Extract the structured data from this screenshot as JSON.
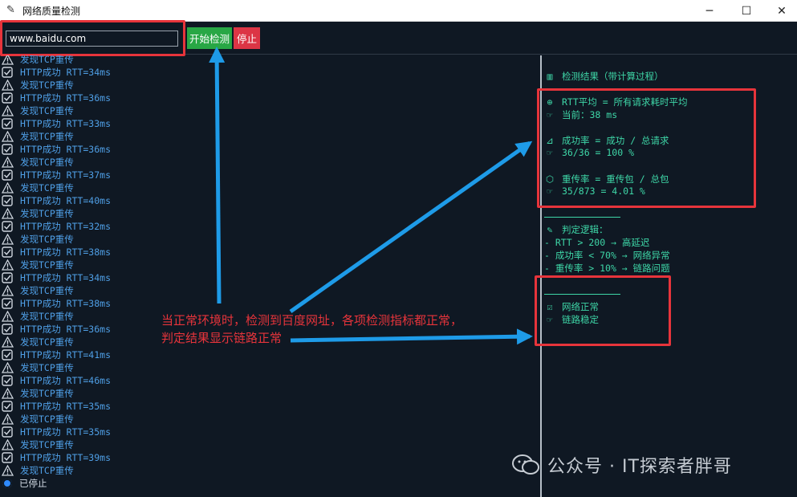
{
  "window": {
    "title": "网络质量检测",
    "app_icon": "feather-icon",
    "controls": [
      "─",
      "☐",
      "✕"
    ]
  },
  "toolbar": {
    "url_value": "www.baidu.com",
    "start_label": "开始检测",
    "stop_label": "停止"
  },
  "log": [
    {
      "type": "warn",
      "text": "发现TCP重传"
    },
    {
      "type": "ok",
      "text": "HTTP成功 RTT=34ms"
    },
    {
      "type": "warn",
      "text": "发现TCP重传"
    },
    {
      "type": "ok",
      "text": "HTTP成功 RTT=36ms"
    },
    {
      "type": "warn",
      "text": "发现TCP重传"
    },
    {
      "type": "ok",
      "text": "HTTP成功 RTT=33ms"
    },
    {
      "type": "warn",
      "text": "发现TCP重传"
    },
    {
      "type": "ok",
      "text": "HTTP成功 RTT=36ms"
    },
    {
      "type": "warn",
      "text": "发现TCP重传"
    },
    {
      "type": "ok",
      "text": "HTTP成功 RTT=37ms"
    },
    {
      "type": "warn",
      "text": "发现TCP重传"
    },
    {
      "type": "ok",
      "text": "HTTP成功 RTT=40ms"
    },
    {
      "type": "warn",
      "text": "发现TCP重传"
    },
    {
      "type": "ok",
      "text": "HTTP成功 RTT=32ms"
    },
    {
      "type": "warn",
      "text": "发现TCP重传"
    },
    {
      "type": "ok",
      "text": "HTTP成功 RTT=38ms"
    },
    {
      "type": "warn",
      "text": "发现TCP重传"
    },
    {
      "type": "ok",
      "text": "HTTP成功 RTT=34ms"
    },
    {
      "type": "warn",
      "text": "发现TCP重传"
    },
    {
      "type": "ok",
      "text": "HTTP成功 RTT=38ms"
    },
    {
      "type": "warn",
      "text": "发现TCP重传"
    },
    {
      "type": "ok",
      "text": "HTTP成功 RTT=36ms"
    },
    {
      "type": "warn",
      "text": "发现TCP重传"
    },
    {
      "type": "ok",
      "text": "HTTP成功 RTT=41ms"
    },
    {
      "type": "warn",
      "text": "发现TCP重传"
    },
    {
      "type": "ok",
      "text": "HTTP成功 RTT=46ms"
    },
    {
      "type": "warn",
      "text": "发现TCP重传"
    },
    {
      "type": "ok",
      "text": "HTTP成功 RTT=35ms"
    },
    {
      "type": "warn",
      "text": "发现TCP重传"
    },
    {
      "type": "ok",
      "text": "HTTP成功 RTT=35ms"
    },
    {
      "type": "warn",
      "text": "发现TCP重传"
    },
    {
      "type": "ok",
      "text": "HTTP成功 RTT=39ms"
    },
    {
      "type": "warn",
      "text": "发现TCP重传"
    },
    {
      "type": "stopped",
      "text": "已停止"
    }
  ],
  "results": {
    "header": "检测结果（带计算过程）",
    "rtt_title": "RTT平均 = 所有请求耗时平均",
    "rtt_value": "当前：38 ms",
    "success_title": "成功率 = 成功 / 总请求",
    "success_value": "36/36 = 100 %",
    "retrans_title": "重传率 = 重传包 / 总包",
    "retrans_value": "35/873 = 4.01 %",
    "logic_title": "判定逻辑：",
    "logic_lines": [
      "- RTT > 200 → 高延迟",
      "- 成功率 < 70% → 网络异常",
      "- 重传率 > 10% → 链路问题"
    ],
    "verdict_network": "网络正常",
    "verdict_link": "链路稳定"
  },
  "annotation": {
    "line1": "当正常环境时，检测到百度网址，各项检测指标都正常，",
    "line2": "判定结果显示链路正常"
  },
  "watermark": "公众号 · IT探索者胖哥",
  "colors": {
    "background": "#0f1823",
    "log_text": "#4f9fe6",
    "result_text": "#3ed6a7",
    "annotation_red": "#e7343b",
    "arrow_blue": "#1e9be8",
    "start_button": "#28a745",
    "stop_button": "#dc3545"
  }
}
